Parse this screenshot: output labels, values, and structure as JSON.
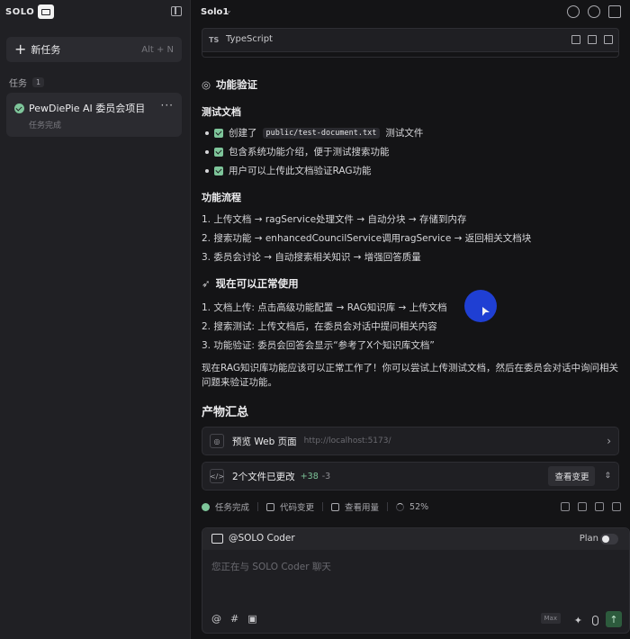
{
  "sidebar": {
    "brand": "SOLO",
    "new_task_label": "新任务",
    "new_task_shortcut": "Alt + N",
    "tasks_title": "任务",
    "tasks_count": "1",
    "task": {
      "name": "PewDiePie AI 委员会项目",
      "status": "任务完成",
      "more": "···"
    }
  },
  "topbar": {
    "title": "Solo1",
    "chevron": "⌄"
  },
  "codeblock": {
    "lang_badge": "TS",
    "lang": "TypeScript"
  },
  "content": {
    "verify_heading": "功能验证",
    "test_doc_heading": "测试文档",
    "checklist": [
      {
        "prefix": "创建了",
        "code": "public/test-document.txt",
        "suffix": "测试文件"
      },
      {
        "text": "包含系统功能介绍，便于测试搜索功能"
      },
      {
        "text": "用户可以上传此文档验证RAG功能"
      }
    ],
    "flow_heading": "功能流程",
    "flow": [
      "1. 上传文档 → ragService处理文件 → 自动分块 → 存储到内存",
      "2. 搜索功能 → enhancedCouncilService调用ragService → 返回相关文档块",
      "3. 委员会讨论 → 自动搜索相关知识 → 增强回答质量"
    ],
    "ready_heading": "现在可以正常使用",
    "ready": [
      "1. 文档上传: 点击高级功能配置 → RAG知识库 → 上传文档",
      "2. 搜索测试: 上传文档后，在委员会对话中提问相关内容",
      "3. 功能验证: 委员会回答会显示“参考了X个知识库文档”"
    ],
    "summary": "现在RAG知识库功能应该可以正常工作了！你可以尝试上传测试文档，然后在委员会对话中询问相关问题来验证功能。",
    "artifacts_heading": "产物汇总"
  },
  "artifacts": {
    "preview_label": "预览 Web 页面",
    "preview_url": "http://localhost:5173/",
    "files_label": "2个文件已更改",
    "added": "+38",
    "removed": "-3",
    "review_button": "查看变更"
  },
  "statusbar": {
    "done": "任务完成",
    "code_changes": "代码变更",
    "usage": "查看用量",
    "progress": "52%"
  },
  "composer": {
    "agent": "@SOLO Coder",
    "plan": "Plan",
    "placeholder": "您正在与 SOLO Coder 聊天",
    "model_badge": "Max",
    "at_tool": "@",
    "hash_tool": "#",
    "send": "↑"
  },
  "colors": {
    "accent_green": "#7ec59a",
    "cursor_blue": "#1f3fd3"
  }
}
